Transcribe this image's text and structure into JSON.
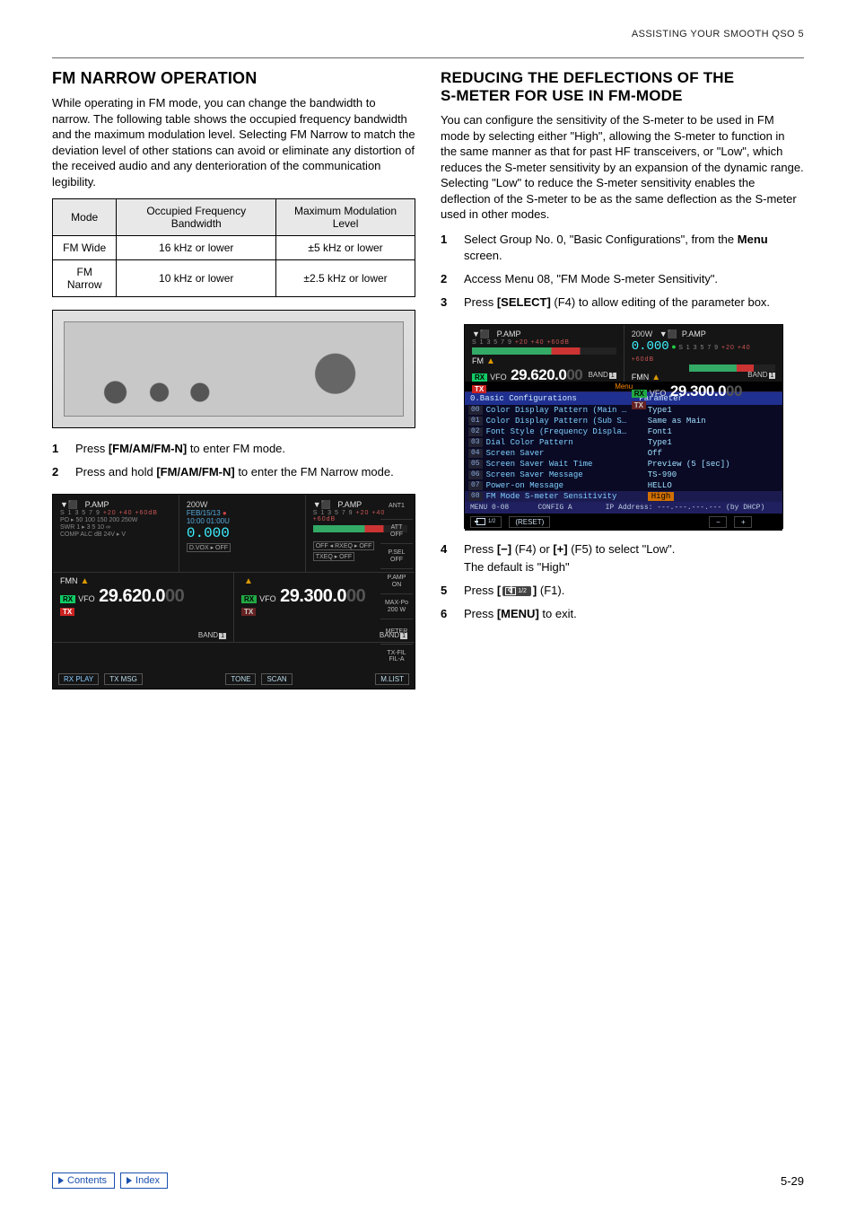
{
  "runhead": "ASSISTING YOUR SMOOTH QSO 5",
  "left": {
    "h1": "FM NARROW OPERATION",
    "intro": "While operating in FM mode, you can change the bandwidth to narrow. The following table shows the occupied frequency bandwidth and the maximum modulation level. Selecting FM Narrow to match the deviation level of other stations can avoid or eliminate any distortion of the received audio and any denterioration of the communication legibility.",
    "table": {
      "head": [
        "Mode",
        "Occupied Frequency Bandwidth",
        "Maximum Modulation Level"
      ],
      "rows": [
        [
          "FM Wide",
          "16 kHz or lower",
          "±5 kHz or lower"
        ],
        [
          "FM Narrow",
          "10 kHz or lower",
          "±2.5 kHz or lower"
        ]
      ]
    },
    "steps": [
      {
        "pre": "Press ",
        "bold": "[FM/AM/FM-N]",
        "post": " to enter FM mode."
      },
      {
        "pre": "Press and hold ",
        "bold": "[FM/AM/FM-N]",
        "post": " to enter the FM Narrow mode."
      }
    ],
    "lcd": {
      "pamp": "P.AMP",
      "s_scale": "S 1 3 5 7 9",
      "s_ext": "+20 +40 +60dB",
      "date": "FEB/15/13",
      "time": "10:00 01:00U",
      "readout": "0.000",
      "dvox": "D.VOX ▸ OFF",
      "pow": "200W",
      "rxeq": "OFF ◂ RXEQ ▸ OFF",
      "txeq": "TXEQ ▸ OFF",
      "fmn": "FMN",
      "rx": "RX",
      "tx": "TX",
      "vfo": "VFO",
      "freq_main": "29.620.000",
      "freq_sub": "29.300.000",
      "band": "BAND",
      "band_num": "1",
      "side": [
        {
          "a": "ANT1",
          "b": ""
        },
        {
          "a": "ATT",
          "b": "OFF"
        },
        {
          "a": "P.SEL",
          "b": "OFF"
        },
        {
          "a": "P.AMP",
          "b": "ON"
        },
        {
          "a": "MAX-Po",
          "b": "200 W"
        },
        {
          "a": "METER",
          "b": ""
        },
        {
          "a": "TX-FIL",
          "b": "FIL-A"
        }
      ],
      "bottom": [
        "RX PLAY",
        "TX MSG",
        "TONE",
        "SCAN",
        "M.LIST"
      ]
    }
  },
  "right": {
    "h1a": "REDUCING THE DEFLECTIONS OF THE",
    "h1b": "S-METER FOR USE IN FM-MODE",
    "intro": "You can configure the sensitivity of the S-meter to be used in FM mode by selecting either \"High\", allowing the S-meter to function in the same manner as that for past HF transceivers, or \"Low\", which reduces the S-meter sensitivity by an expansion of the dynamic range. Selecting \"Low\" to reduce the S-meter sensitivity enables the deflection of the S-meter to be as the same deflection as the S-meter used in other modes.",
    "steps123": [
      {
        "pre": "Select Group No. 0, \"Basic Configurations\", from the ",
        "bold": "Menu",
        "post": " screen."
      },
      {
        "plain": "Access Menu 08, \"FM Mode S-meter Sensitivity\"."
      },
      {
        "pre": "Press ",
        "bold": "[SELECT]",
        "post": " (F4) to allow editing of the parameter box."
      }
    ],
    "menu": {
      "pamp": "P.AMP",
      "pow": "200W",
      "readout": "0.000",
      "fm": "FM",
      "fmn": "FMN",
      "rx": "RX",
      "tx": "TX",
      "vfo": "VFO",
      "freq_main": "29.620.000",
      "freq_sub": "29.300.000",
      "band": "BAND",
      "band_num": "1",
      "group": "0.Basic Configurations",
      "paramhead": "Parameter",
      "menutab": "Menu",
      "rows": [
        {
          "idx": "00",
          "name": "Color Display Pattern (Main …",
          "val": "Type1"
        },
        {
          "idx": "01",
          "name": "Color Display Pattern (Sub S…",
          "val": "Same as Main"
        },
        {
          "idx": "02",
          "name": "Font Style (Frequency Displa…",
          "val": "Font1"
        },
        {
          "idx": "03",
          "name": "Dial Color Pattern",
          "val": "Type1"
        },
        {
          "idx": "04",
          "name": "Screen Saver",
          "val": "Off"
        },
        {
          "idx": "05",
          "name": "Screen Saver Wait Time",
          "val": "Preview (5 [sec])"
        },
        {
          "idx": "06",
          "name": "Screen Saver Message",
          "val": "TS-990"
        },
        {
          "idx": "07",
          "name": "Power-on Message",
          "val": "HELLO"
        },
        {
          "idx": "08",
          "name": "FM Mode S-meter Sensitivity",
          "val": "High"
        }
      ],
      "status_l": "MENU 0-08",
      "status_m": "CONFIG A",
      "status_r": "IP Address: ---.---.---.--- (by DHCP)",
      "reset": "(RESET)",
      "minus": "−",
      "plus": "+"
    },
    "steps456": [
      {
        "pre": "Press ",
        "bold1": "[−]",
        "mid": " (F4) or ",
        "bold2": "[+]",
        "post": " (F5) to select \"Low\".",
        "sub": "The default is \"High\""
      },
      {
        "pre": "Press ",
        "bold": "[",
        "esc_suffix": "]",
        "post": " (F1)."
      },
      {
        "pre": "Press ",
        "bold": "[MENU]",
        "post": " to exit."
      }
    ],
    "esc_num": "1/2"
  },
  "footer": {
    "contents": "Contents",
    "index": "Index",
    "pagenum": "5-29"
  }
}
